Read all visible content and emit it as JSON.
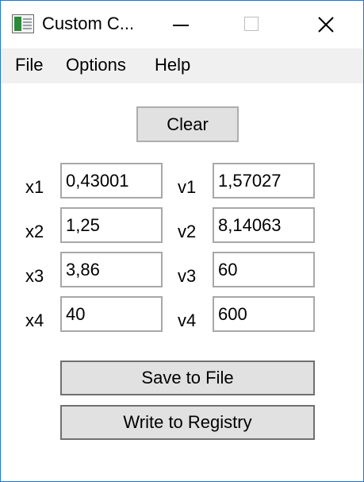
{
  "window": {
    "title": "Custom C...",
    "accent_color": "#1b78d1"
  },
  "titlebar_buttons": {
    "minimize_icon": "minimize-icon",
    "maximize_icon": "maximize-icon",
    "close_icon": "close-icon"
  },
  "menu": {
    "file": "File",
    "options": "Options",
    "help": "Help"
  },
  "buttons": {
    "clear": "Clear",
    "save_to_file": "Save to File",
    "write_to_registry": "Write to Registry"
  },
  "fields": {
    "x1": {
      "label": "x1",
      "value": "0,43001"
    },
    "x2": {
      "label": "x2",
      "value": "1,25"
    },
    "x3": {
      "label": "x3",
      "value": "3,86"
    },
    "x4": {
      "label": "x4",
      "value": "40"
    },
    "v1": {
      "label": "v1",
      "value": "1,57027"
    },
    "v2": {
      "label": "v2",
      "value": "8,14063"
    },
    "v3": {
      "label": "v3",
      "value": "60"
    },
    "v4": {
      "label": "v4",
      "value": "600"
    }
  }
}
